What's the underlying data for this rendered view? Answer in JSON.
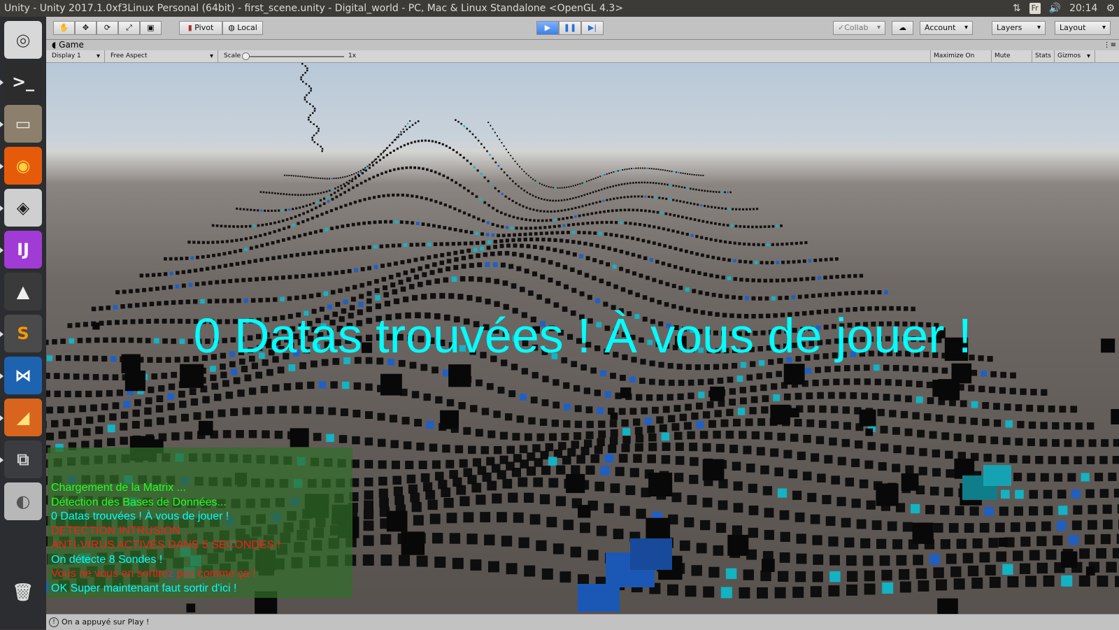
{
  "system": {
    "window_title": "Unity - Unity 2017.1.0xf3Linux Personal (64bit) - first_scene.unity - Digital_world - PC, Mac & Linux Standalone <OpenGL 4.3>",
    "keyboard": "Fr",
    "time": "20:14"
  },
  "launcher": [
    {
      "name": "ubuntu-dash-icon",
      "glyph": "◎",
      "bg": "#d8d8d8",
      "fg": "#444"
    },
    {
      "name": "terminal-icon",
      "glyph": ">_",
      "bg": "#2c2c2c",
      "fg": "#eee"
    },
    {
      "name": "files-icon",
      "glyph": "▭",
      "bg": "#8c7f6c",
      "fg": "#eee"
    },
    {
      "name": "firefox-icon",
      "glyph": "◉",
      "bg": "#e55b0a",
      "fg": "#ffcf3f"
    },
    {
      "name": "unity-icon",
      "glyph": "◈",
      "bg": "#cfcfcf",
      "fg": "#222"
    },
    {
      "name": "intellij-icon",
      "glyph": "IJ",
      "bg": "#a13bd6",
      "fg": "#fff"
    },
    {
      "name": "inkscape-icon",
      "glyph": "▲",
      "bg": "#3a3a3a",
      "fg": "#eee"
    },
    {
      "name": "sublime-text-icon",
      "glyph": "S",
      "bg": "#4a4a4a",
      "fg": "#ff9800"
    },
    {
      "name": "vscode-icon",
      "glyph": "⋈",
      "bg": "#1e63b0",
      "fg": "#fff"
    },
    {
      "name": "matlab-icon",
      "glyph": "◢",
      "bg": "#d8641e",
      "fg": "#ffe27a"
    },
    {
      "name": "workspace-switcher-icon",
      "glyph": "⧉",
      "bg": "#3a3c3f",
      "fg": "#ccc"
    },
    {
      "name": "disk-icon",
      "glyph": "◐",
      "bg": "#b8b8b8",
      "fg": "#555"
    },
    {
      "name": "trash-icon",
      "glyph": "🗑",
      "bg": "#2b2d30",
      "fg": "#ddd"
    }
  ],
  "toolbar": {
    "pivot": "Pivot",
    "local": "Local",
    "collab": "Collab",
    "account": "Account",
    "layers": "Layers",
    "layout": "Layout"
  },
  "game": {
    "tab_title": "Game",
    "display": "Display 1",
    "aspect": "Free Aspect",
    "scale_label": "Scale",
    "scale_value": "1x",
    "maximize": "Maximize On Play",
    "mute": "Mute Audio",
    "stats": "Stats",
    "gizmos": "Gizmos"
  },
  "overlay": {
    "big_message": "0 Datas trouvées ! À vous de jouer !",
    "console_lines": [
      {
        "text": "Chargement de la Matrix ...",
        "color": "#22ff22"
      },
      {
        "text": "Détection des Bases de Données...",
        "color": "#22ff22"
      },
      {
        "text": "0 Datas trouvées ! À vous de jouer !",
        "color": "#00ffff"
      },
      {
        "text": "DETECTION INTRUSION ...",
        "color": "#ff1a1a"
      },
      {
        "text": "ANTI-VIRUS ACTIVÉS DANS 5 SECONDES !",
        "color": "#ff1a1a"
      },
      {
        "text": "On détecte 8 Sondes !",
        "color": "#00ffff"
      },
      {
        "text": "Vous ne vous en sortirez pas comme ça !",
        "color": "#ff1a1a"
      },
      {
        "text": "OK Super maintenant faut sortir d'ici !",
        "color": "#00ffff"
      }
    ]
  },
  "status": {
    "message": "On a appuyé sur Play !"
  }
}
